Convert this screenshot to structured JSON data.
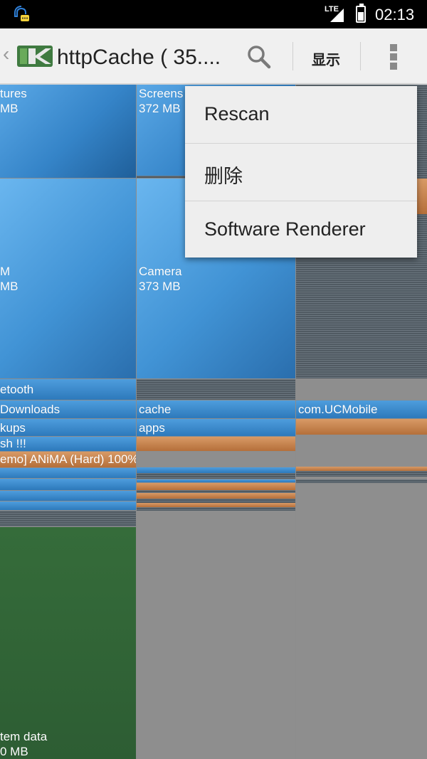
{
  "status_bar": {
    "network": "LTE",
    "time": "02:13",
    "notification_icon": "chat-notification-icon",
    "battery_level": 0.55
  },
  "action_bar": {
    "back_icon": "back-caret-icon",
    "app_icon": "app-logo-icon",
    "title": "httpCache ( 35....",
    "search_icon": "search-icon",
    "display_button": "显示",
    "overflow_icon": "overflow-menu-icon"
  },
  "treemap": {
    "tiles": [
      {
        "name": "Pictures",
        "text": "tures",
        "size": "MB"
      },
      {
        "name": "Screenshots",
        "text": "Screens",
        "size": "372 MB"
      },
      {
        "name": "DCIM",
        "text": "M",
        "size": "MB"
      },
      {
        "name": "Camera",
        "text": "Camera",
        "size": "373 MB"
      },
      {
        "name": "bluetooth",
        "text": "etooth"
      },
      {
        "name": "Downloads",
        "text": "Downloads"
      },
      {
        "name": "cache",
        "text": "cache"
      },
      {
        "name": "com.UCMobile",
        "text": "com.UCMobile"
      },
      {
        "name": "backups",
        "text": "kups"
      },
      {
        "name": "apps",
        "text": "apps"
      },
      {
        "name": "flash",
        "text": "sh !!!"
      },
      {
        "name": "anima",
        "text": "emo] ANiMA (Hard) 100%"
      },
      {
        "name": "system-data",
        "text": "tem data",
        "size": "0 MB"
      }
    ]
  },
  "menu": {
    "items": [
      {
        "label": "Rescan"
      },
      {
        "label": "删除"
      },
      {
        "label": "Software Renderer"
      }
    ]
  },
  "colors": {
    "status_bar_bg": "#000000",
    "action_bar_bg": "#f0f0f0",
    "tile_blue": "#3584c8",
    "tile_orange": "#b56f3a",
    "tile_green": "#2d5d33",
    "empty_gray": "#8e8e8e",
    "menu_bg": "#eeeeee"
  }
}
